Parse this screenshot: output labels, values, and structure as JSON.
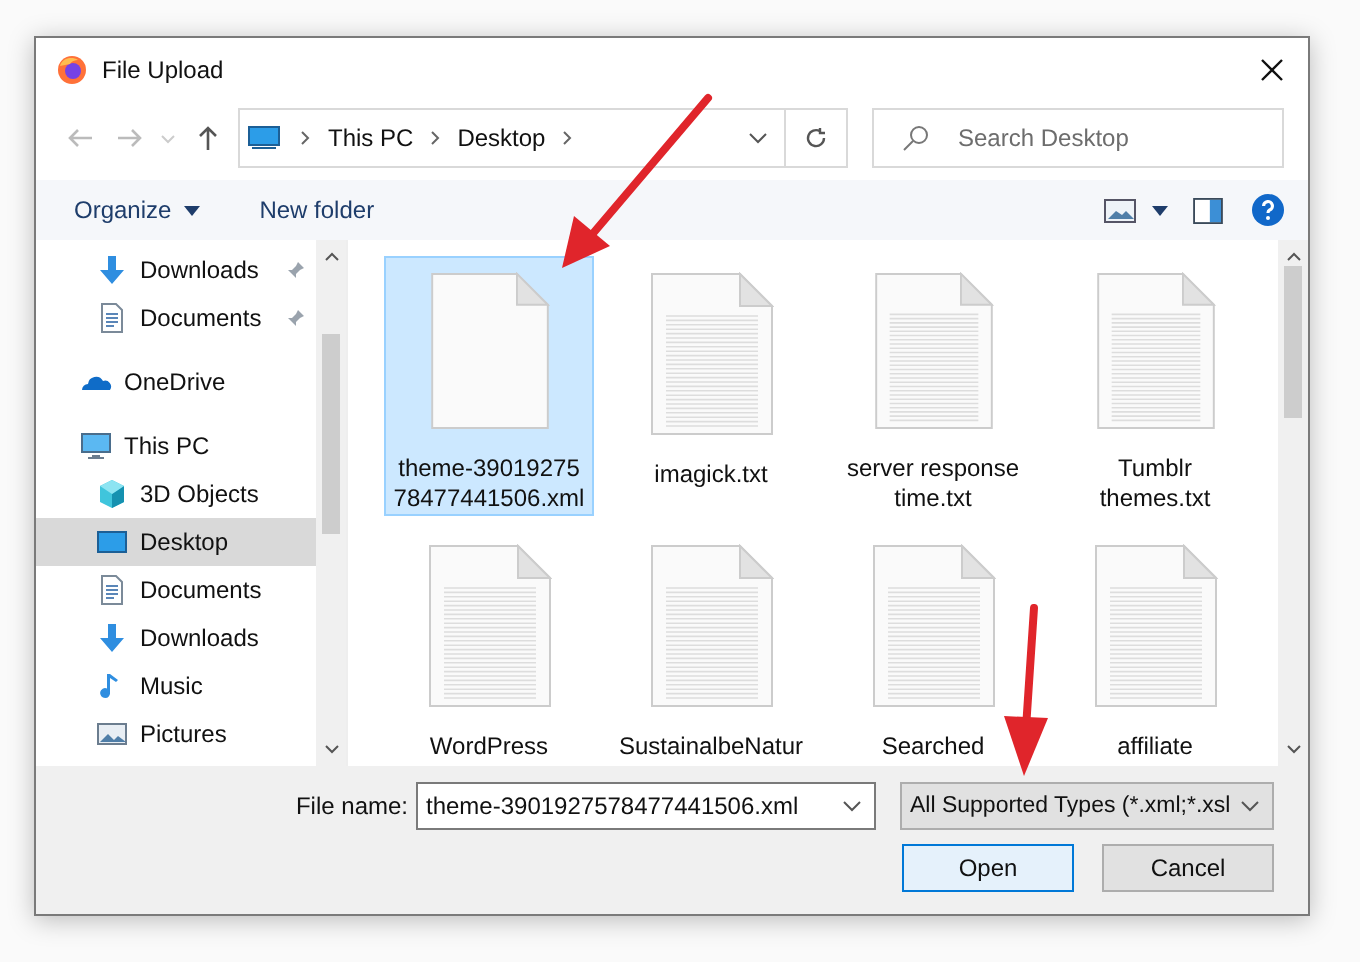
{
  "window": {
    "title": "File Upload"
  },
  "address": {
    "crumbs": [
      "This PC",
      "Desktop"
    ]
  },
  "search": {
    "placeholder": "Search Desktop"
  },
  "toolbar": {
    "organize": "Organize",
    "new_folder": "New folder"
  },
  "sidebar": {
    "scrolled_children": [
      {
        "label": "Downloads",
        "kind": "download",
        "pinned": true,
        "selected": false
      },
      {
        "label": "Documents",
        "kind": "document",
        "pinned": true,
        "selected": false
      }
    ],
    "items": [
      {
        "label": "OneDrive",
        "kind": "cloud",
        "selected": false
      },
      {
        "label": "This PC",
        "kind": "computer",
        "selected": false,
        "children": [
          {
            "label": "3D Objects",
            "kind": "cube",
            "selected": false
          },
          {
            "label": "Desktop",
            "kind": "desktop",
            "selected": true
          },
          {
            "label": "Documents",
            "kind": "document",
            "selected": false
          },
          {
            "label": "Downloads",
            "kind": "download",
            "selected": false
          },
          {
            "label": "Music",
            "kind": "music",
            "selected": false
          },
          {
            "label": "Pictures",
            "kind": "pictures",
            "selected": false
          }
        ]
      }
    ]
  },
  "files": [
    {
      "lines": [
        "theme-39019275",
        "78477441506.xml"
      ],
      "kind": "blank",
      "selected": true
    },
    {
      "lines": [
        "imagick.txt"
      ],
      "kind": "text",
      "selected": false
    },
    {
      "lines": [
        "server response",
        "time.txt"
      ],
      "kind": "text",
      "selected": false
    },
    {
      "lines": [
        "Tumblr",
        "themes.txt"
      ],
      "kind": "text",
      "selected": false
    },
    {
      "lines": [
        "WordPress"
      ],
      "kind": "text",
      "selected": false
    },
    {
      "lines": [
        "SustainalbeNatur"
      ],
      "kind": "text",
      "selected": false
    },
    {
      "lines": [
        "Searched"
      ],
      "kind": "text",
      "selected": false
    },
    {
      "lines": [
        "affiliate"
      ],
      "kind": "text",
      "selected": false
    }
  ],
  "file_name": {
    "label": "File name:",
    "value": "theme-3901927578477441506.xml"
  },
  "file_type": {
    "value": "All Supported Types (*.xml;*.xsl"
  },
  "buttons": [
    {
      "label": "Open",
      "kind": "primary"
    },
    {
      "label": "Cancel",
      "kind": "normal"
    }
  ]
}
